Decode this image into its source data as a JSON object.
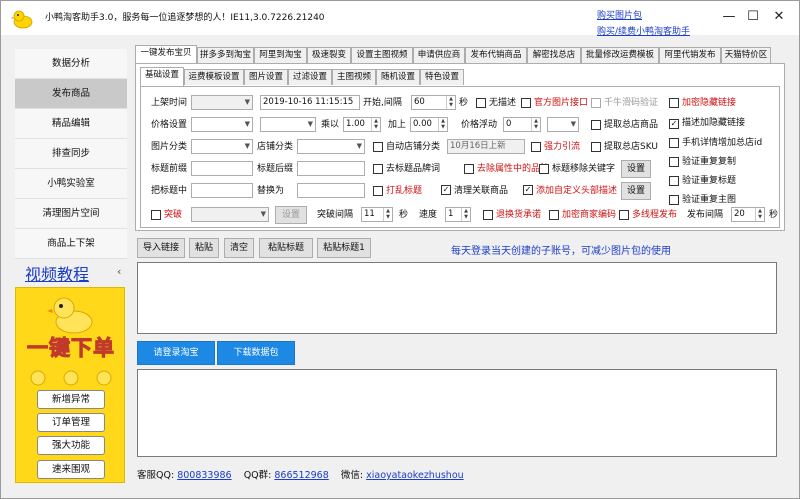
{
  "window": {
    "title": "小鸭淘客助手3.0，服务每一位追逐梦想的人！IE11,3.0.7226.21240",
    "links": [
      "购买图片包",
      "购买/续费小鸭淘客助手"
    ],
    "controls": [
      "—",
      "☐",
      "✕"
    ]
  },
  "sidebar": {
    "items": [
      "数据分析",
      "发布商品",
      "精品编辑",
      "排查同步",
      "小鸭实验室",
      "清理图片空间",
      "商品上下架"
    ],
    "active_index": 1
  },
  "video": {
    "title": "视频教程",
    "collapse": "‹"
  },
  "promo": {
    "banner": "一键下单",
    "buttons": [
      "新增异常",
      "订单管理",
      "强大功能",
      "速来围观"
    ]
  },
  "main_tabs": {
    "items": [
      "一键发布宝贝",
      "拼多多到淘宝",
      "阿里到淘宝",
      "极速裂变",
      "设置主图视频",
      "申请供应商",
      "发布代销商品",
      "解密找总店",
      "批量修改运费模板",
      "阿里代销发布",
      "天猫特价区"
    ],
    "active_index": 0
  },
  "sub_tabs": {
    "items": [
      "基础设置",
      "运费模板设置",
      "图片设置",
      "过滤设置",
      "主图视频",
      "随机设置",
      "特色设置"
    ],
    "active_index": 0
  },
  "form": {
    "row1": {
      "shelf_time_label": "上架时间",
      "datetime": "2019-10-16 11:15:15",
      "start_interval_label": "开始,间隔",
      "interval_value": "60",
      "seconds": "秒",
      "no_watermark": "无描述",
      "official_image": "官方图片接口",
      "captcha": "千牛滑码验证",
      "hidden_link": "加密隐藏链接"
    },
    "row2": {
      "price_label": "价格设置",
      "multiply_label": "乘以",
      "multiply_value": "1.00",
      "add_label": "加上",
      "add_value": "0.00",
      "float_label": "价格浮动",
      "float_value": "0",
      "extract_store": "提取总店商品",
      "describe_hidden": "描述加隐藏链接"
    },
    "row3": {
      "category_label": "图片分类",
      "store_category_label": "店铺分类",
      "auto_category": "自动店铺分类",
      "date_placeholder": "10月16日上新",
      "strong_drain": "强力引流",
      "extract_sku": "提取总店SKU",
      "mobile_detail": "手机详情增加总店id"
    },
    "row4": {
      "prefix_label": "标题前缀",
      "suffix_label": "标题后缀",
      "remove_brand": "去标题品牌词",
      "remove_attr_brand": "去除属性中的品牌",
      "remove_keywords": "标题移除关键字",
      "settings_btn": "设置",
      "verify_dup_copy": "验证重复复制"
    },
    "row5": {
      "title_middle_label": "把标题中",
      "replace_label": "替换为",
      "shuffle_title": "打乱标题",
      "clean_related": "清理关联商品",
      "add_custom_header": "添加自定义头部描述",
      "settings_btn": "设置",
      "verify_dup_title": "验证重复标题"
    },
    "row6": {
      "breakthrough": "突破",
      "settings_btn": "设置",
      "breakthrough_interval_label": "突破间隔",
      "breakthrough_interval_value": "11",
      "seconds": "秒",
      "speed_label": "速度",
      "speed_value": "1",
      "refund_promise": "退换货承诺",
      "encrypt_code": "加密商家编码",
      "multithread": "多线程发布",
      "publish_interval_label": "发布间隔",
      "publish_interval_value": "20",
      "seconds2": "秒",
      "verify_dup_main_image": "验证重复主图"
    }
  },
  "checked": {
    "describe_hidden": true,
    "clean_related": true,
    "add_custom_header": true
  },
  "toolbar": {
    "buttons": [
      "导入链接",
      "粘贴",
      "清空",
      "粘贴标题",
      "粘贴标题1"
    ],
    "notice": "每天登录当天创建的子账号，可减少图片包的使用"
  },
  "actions": {
    "login": "请登录淘宝",
    "download": "下载数据包"
  },
  "footer": {
    "qq_label": "客服QQ:",
    "qq": "800833986",
    "group_label": "QQ群:",
    "group": "866512968",
    "wechat_label": "微信:",
    "wechat": "xiaoyataokezhushou"
  }
}
